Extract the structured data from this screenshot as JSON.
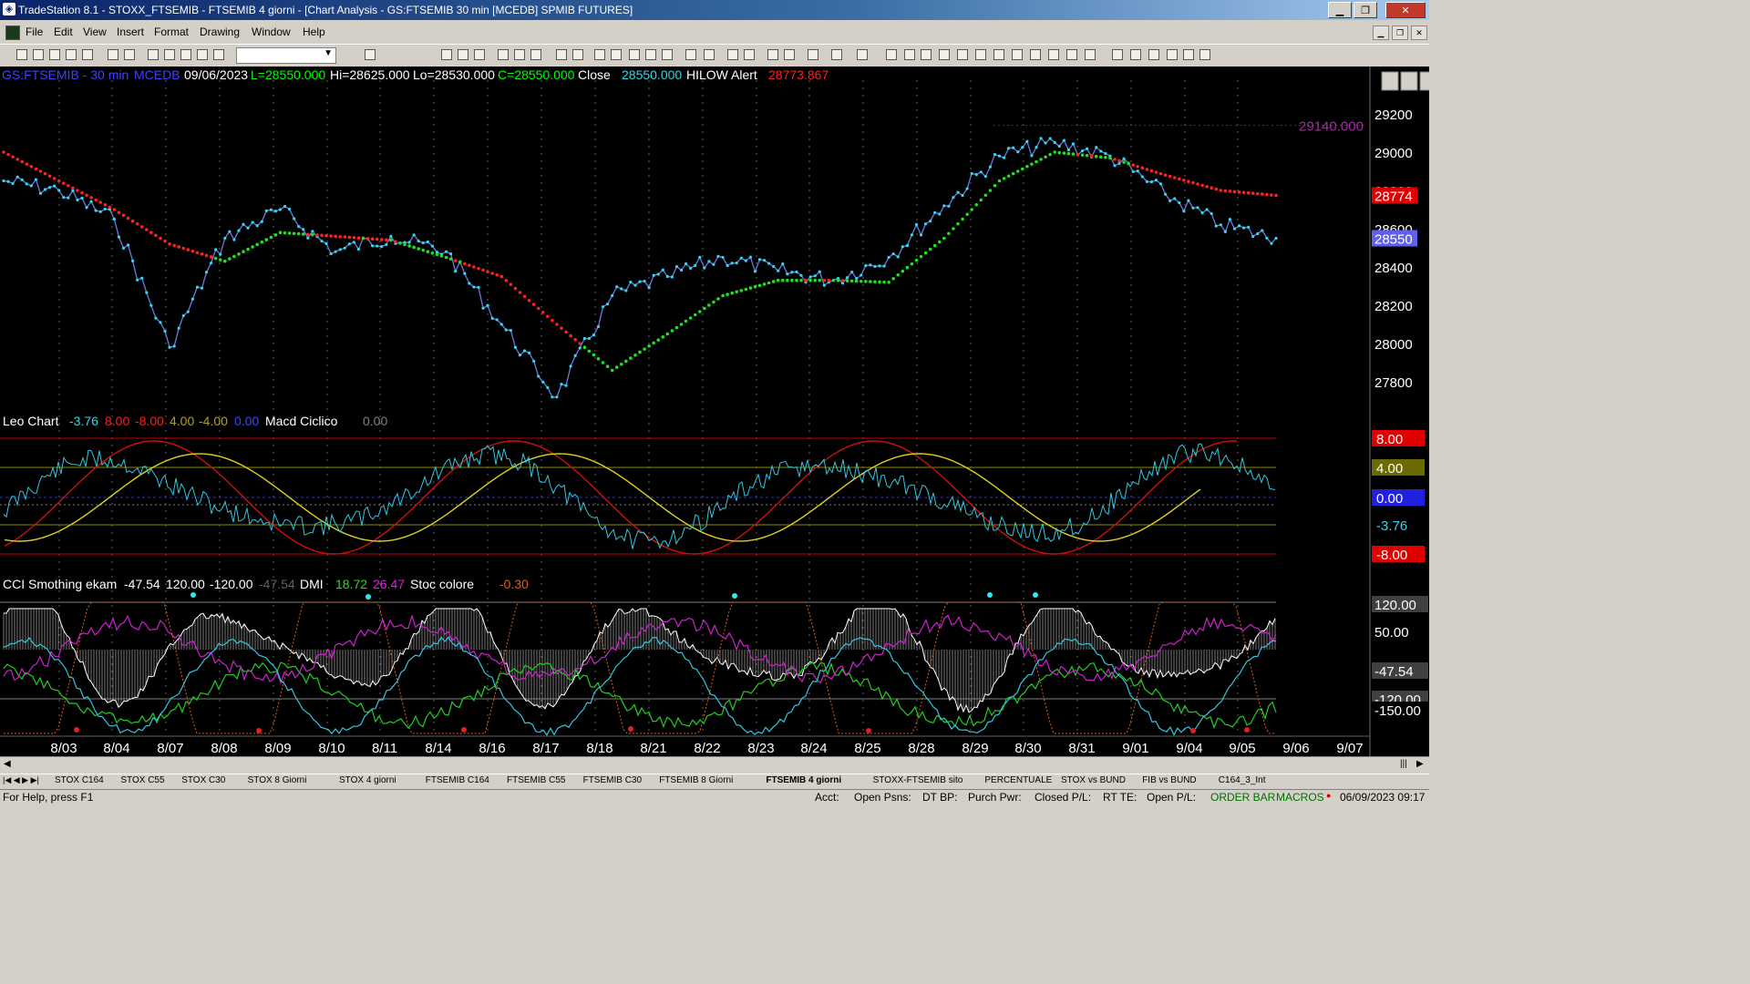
{
  "window": {
    "title": "TradeStation 8.1 - STOXX_FTSEMIB - FTSEMIB  4 giorni - [Chart Analysis - GS:FTSEMIB  30 min  [MCEDB] SPMIB FUTURES]",
    "minimize": "▁",
    "maximize": "❐",
    "close": "✕"
  },
  "menu": [
    "File",
    "Edit",
    "View",
    "Insert",
    "Format",
    "Drawing",
    "Window",
    "Help"
  ],
  "chart": {
    "header": {
      "symbol": "GS:FTSEMIB - 30 min",
      "source": "MCEDB",
      "date": "09/06/2023",
      "last": "L=28550.000",
      "high": "Hi=28625.000",
      "low": "Lo=28530.000",
      "close_val": "C=28550.000",
      "close_label": "Close",
      "close_num": "28550.000",
      "alert_label": "HILOW Alert",
      "alert_val": "28773.867"
    },
    "resistance_label": "29140.000",
    "price_ticks": [
      "29200",
      "29000",
      "28800",
      "28600",
      "28400",
      "28200",
      "28000",
      "27800"
    ],
    "price_tags": {
      "red": "28774",
      "blue": "28550"
    }
  },
  "panel2": {
    "title": "Leo Chart",
    "values": [
      "-3.76",
      "8.00",
      "-8.00",
      "4.00",
      "-4.00",
      "0.00"
    ],
    "macd_label": "Macd Ciclico",
    "macd_val": "0.00",
    "tags": [
      "8.00",
      "4.00",
      "0.00",
      "-3.76",
      "-8.00"
    ]
  },
  "panel3": {
    "title": "CCI Smothing ekam",
    "values": [
      "-47.54",
      "120.00",
      "-120.00",
      "-47.54"
    ],
    "dmi_label": "DMI",
    "dmi_values": [
      "18.72",
      "26.47"
    ],
    "stoc_label": "Stoc colore",
    "stoc_val": "-0.30",
    "tags": [
      "120.00",
      "50.00",
      "-47.54",
      "-120.00",
      "-150.00"
    ]
  },
  "dates": [
    "8/03",
    "8/04",
    "8/07",
    "8/08",
    "8/09",
    "8/10",
    "8/11",
    "8/14",
    "8/16",
    "8/17",
    "8/18",
    "8/21",
    "8/22",
    "8/23",
    "8/24",
    "8/25",
    "8/28",
    "8/29",
    "8/30",
    "8/31",
    "9/01",
    "9/04",
    "9/05",
    "9/06",
    "9/07"
  ],
  "tabs": [
    "STOX C164",
    "STOX C55",
    "STOX  C30",
    "STOX  8 Giorni",
    "STOX 4 giorni",
    "FTSEMIB C164",
    "FTSEMIB C55",
    "FTSEMIB C30",
    "FTSEMIB  8 Giorni",
    "FTSEMIB  4 giorni",
    "STOXX-FTSEMIB sito",
    "PERCENTUALE",
    "STOX vs BUND",
    "FIB vs BUND",
    "C164_3_Int"
  ],
  "active_tab": "FTSEMIB  4 giorni",
  "status": {
    "help": "For Help, press F1",
    "acct": "Acct:",
    "open_psns": "Open Psns:",
    "dt_bp": "DT BP:",
    "purch_pwr": "Purch Pwr:",
    "closed_pl": "Closed P/L:",
    "rt_te": "RT TE:",
    "open_pl": "Open P/L:",
    "order_bar": "ORDER BAR",
    "macros": "MACROS",
    "datetime": "06/09/2023 09:17"
  },
  "chart_data": {
    "type": "line",
    "title": "GS:FTSEMIB - 30 min",
    "x": [
      "8/03",
      "8/04",
      "8/07",
      "8/08",
      "8/09",
      "8/10",
      "8/11",
      "8/14",
      "8/16",
      "8/17",
      "8/18",
      "8/21",
      "8/22",
      "8/23",
      "8/24",
      "8/25",
      "8/28",
      "8/29",
      "8/30",
      "8/31",
      "9/01",
      "9/04",
      "9/05",
      "9/06"
    ],
    "series": [
      {
        "name": "Close",
        "values": [
          28850,
          28800,
          28650,
          27980,
          28550,
          28700,
          28480,
          28560,
          28480,
          28100,
          27720,
          28250,
          28350,
          28450,
          28380,
          28330,
          28450,
          28720,
          28980,
          29050,
          28980,
          28780,
          28620,
          28550
        ]
      },
      {
        "name": "HILOW Alert",
        "values": [
          29000,
          28850,
          28700,
          28520,
          28430,
          28580,
          28560,
          28540,
          28450,
          28350,
          28100,
          27860,
          28050,
          28250,
          28330,
          28330,
          28320,
          28550,
          28850,
          29000,
          28970,
          28880,
          28800,
          28774
        ]
      }
    ],
    "ylabel": "",
    "ylim": [
      27650,
      29300
    ],
    "resistance": 29140
  }
}
